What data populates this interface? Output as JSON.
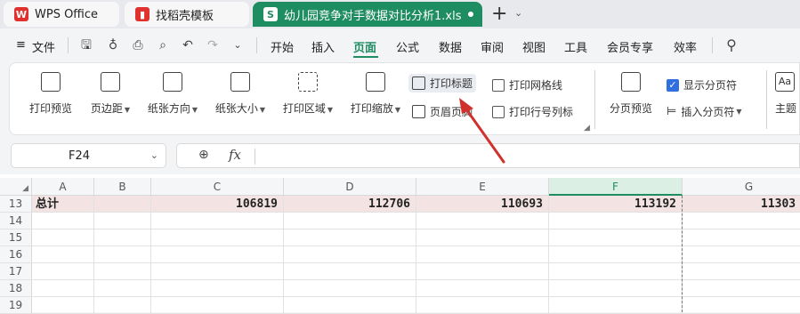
{
  "tabs": [
    {
      "label": "WPS Office",
      "icon": "wps-logo-icon"
    },
    {
      "label": "找稻壳模板",
      "icon": "docer-icon"
    },
    {
      "label": "幼儿园竞争对手数据对比分析1.xls",
      "icon": "sheet-icon",
      "icon_letter": "S",
      "active": true
    }
  ],
  "menubar": {
    "file_label": "文件",
    "items": [
      "开始",
      "插入",
      "页面",
      "公式",
      "数据",
      "审阅",
      "视图",
      "工具",
      "会员专享",
      "效率"
    ],
    "active": "页面"
  },
  "ribbon": {
    "print_preview": "打印预览",
    "margins": "页边距",
    "orientation": "纸张方向",
    "size": "纸张大小",
    "print_area": "打印区域",
    "print_scale": "打印缩放",
    "print_titles": "打印标题",
    "header_footer": "页眉页脚",
    "print_gridlines": "打印网格线",
    "print_row_col_headers": "打印行号列标",
    "page_break_preview": "分页预览",
    "show_page_breaks": "显示分页符",
    "show_page_breaks_checked": true,
    "insert_page_break": "插入分页符",
    "theme_partial": "主题",
    "theme_icon_text": "Aa"
  },
  "formula_bar": {
    "name_box": "F24",
    "fx_label": "fx",
    "value": ""
  },
  "sheet": {
    "columns": [
      "A",
      "B",
      "C",
      "D",
      "E",
      "F",
      "G"
    ],
    "selected_column": "F",
    "rows": [
      {
        "num": "13",
        "cells": [
          "总计",
          "",
          "106819",
          "112706",
          "110693",
          "113192",
          "11303"
        ]
      },
      {
        "num": "14",
        "cells": [
          "",
          "",
          "",
          "",
          "",
          "",
          ""
        ]
      },
      {
        "num": "15",
        "cells": [
          "",
          "",
          "",
          "",
          "",
          "",
          ""
        ]
      },
      {
        "num": "16",
        "cells": [
          "",
          "",
          "",
          "",
          "",
          "",
          ""
        ]
      },
      {
        "num": "17",
        "cells": [
          "",
          "",
          "",
          "",
          "",
          "",
          ""
        ]
      },
      {
        "num": "18",
        "cells": [
          "",
          "",
          "",
          "",
          "",
          "",
          ""
        ]
      },
      {
        "num": "19",
        "cells": [
          "",
          "",
          "",
          "",
          "",
          "",
          ""
        ]
      }
    ]
  },
  "colors": {
    "accent": "#1f8d62",
    "total_row_bg": "#f3e4e3",
    "arrow": "#d0312d",
    "check": "#2f6fe0"
  }
}
